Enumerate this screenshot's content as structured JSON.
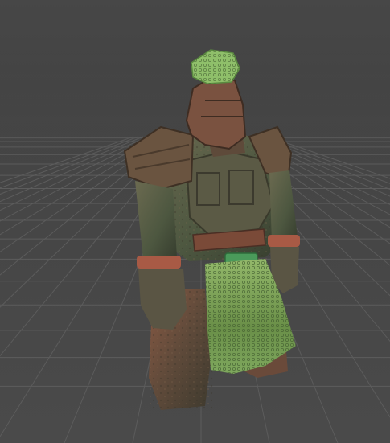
{
  "scene": {
    "background_color": "#474747",
    "grid_color": "#5c5c5c",
    "model_name": "armored-warrior-statue",
    "palette": {
      "bronze": "#7a4a35",
      "bronze_dark": "#4e3328",
      "moss": "#4f5a3f",
      "moss_light": "#6d7a55",
      "jade": "#6f9a4a",
      "jade_light": "#a8cc7a",
      "copper_band": "#a85a45"
    }
  }
}
